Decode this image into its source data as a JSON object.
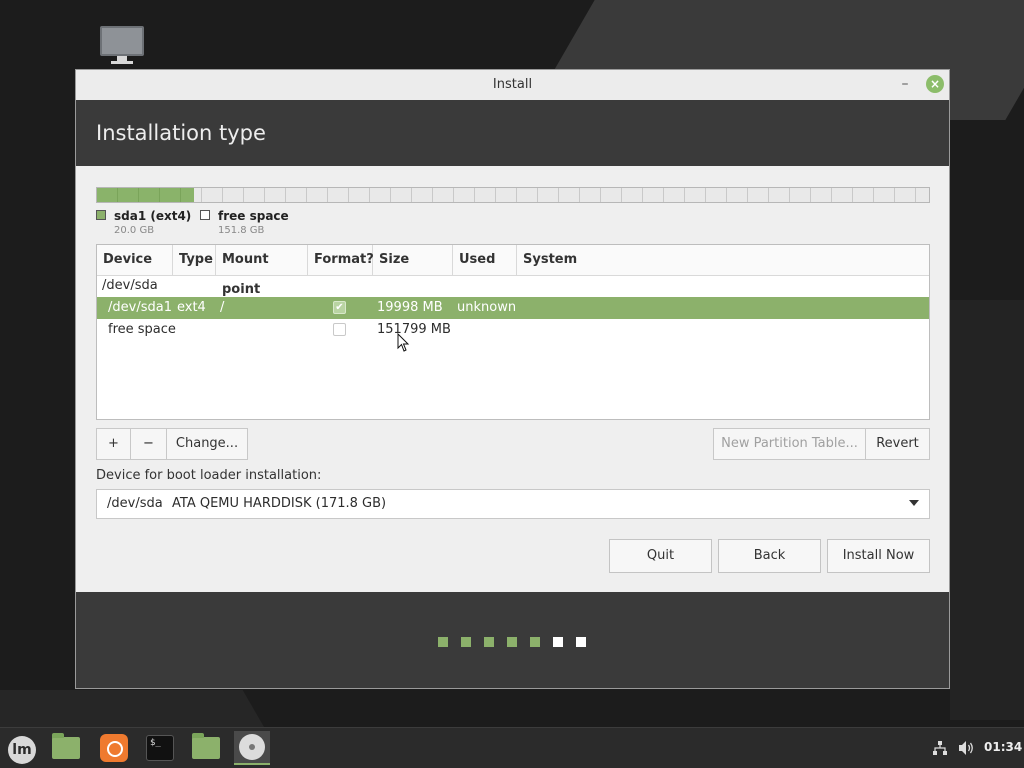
{
  "window": {
    "title": "Install",
    "minimize_glyph": "–",
    "close_glyph": "×"
  },
  "header": {
    "title": "Installation type"
  },
  "partition_bar": {
    "used_fraction": 0.117
  },
  "legend": [
    {
      "name": "sda1 (ext4)",
      "size": "20.0 GB",
      "color": "#8cb16b"
    },
    {
      "name": "free space",
      "size": "151.8 GB",
      "color": "#ffffff"
    }
  ],
  "table": {
    "columns": [
      "Device",
      "Type",
      "Mount point",
      "Format?",
      "Size",
      "Used",
      "System"
    ],
    "disk_row": "/dev/sda",
    "rows": [
      {
        "device": "/dev/sda1",
        "type": "ext4",
        "mount": "/",
        "format": true,
        "size": "19998 MB",
        "used": "unknown",
        "system": "",
        "selected": true
      },
      {
        "device": "free space",
        "type": "",
        "mount": "",
        "format": false,
        "size": "151799 MB",
        "used": "",
        "system": "",
        "selected": false
      }
    ]
  },
  "toolbar": {
    "add_label": "+",
    "remove_label": "−",
    "change_label": "Change...",
    "new_table_label": "New Partition Table...",
    "revert_label": "Revert"
  },
  "bootloader": {
    "label": "Device for boot loader installation:",
    "device": "/dev/sda",
    "description": "ATA QEMU HARDDISK (171.8 GB)"
  },
  "actions": {
    "quit_label": "Quit",
    "back_label": "Back",
    "install_label": "Install Now"
  },
  "progress": {
    "completed_steps": 5,
    "total_steps": 7
  },
  "taskbar": {
    "apps": [
      "mint-menu-icon",
      "files-icon",
      "firefox-icon",
      "terminal-icon",
      "folder-icon",
      "installer-disc-icon"
    ],
    "terminal_prompt": "$_",
    "clock": "01:34"
  },
  "colors": {
    "accent": "#8cb16b",
    "header": "#3a3a3a"
  }
}
